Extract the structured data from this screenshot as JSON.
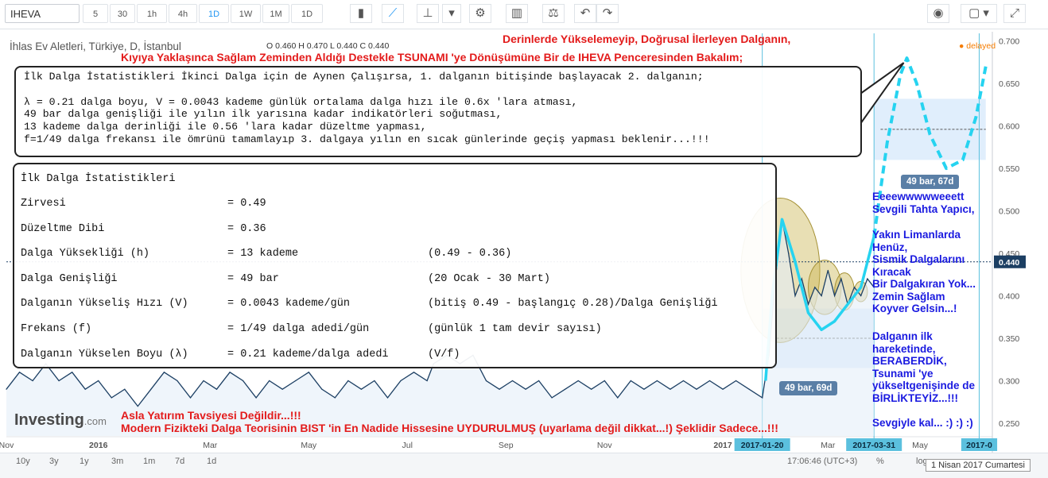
{
  "toolbar": {
    "symbol": "IHEVA",
    "intervals": [
      "5",
      "30",
      "1h",
      "4h",
      "1D",
      "1W",
      "1M",
      "1D"
    ],
    "active_interval": "1D"
  },
  "legend": {
    "title": "İhlas Ev Aletleri, Türkiye, D, İstanbul",
    "ohlc": "O 0.460 H 0.470 L 0.440 C 0.440",
    "delayed": "delayed"
  },
  "headline": {
    "line1": "Derinlerde Yükselemeyip, Doğrusal İlerleyen Dalganın,",
    "line2": "Kıyıya Yaklaşınca Sağlam Zeminden Aldığı Destekle TSUNAMI 'ye Dönüşümüne Bir de IHEVA Penceresinden Bakalım;"
  },
  "callout_lines": [
    "İlk Dalga İstatistikleri İkinci Dalga için de Aynen Çalışırsa, 1. dalganın bitişinde başlayacak 2. dalganın;",
    "",
    "λ = 0.21 dalga boyu, V = 0.0043 kademe günlük ortalama dalga hızı ile 0.6x 'lara atması,",
    "49 bar dalga genişliği ile yılın ilk yarısına kadar indikatörleri soğutması,",
    "13 kademe dalga derinliği ile 0.56 'lara kadar düzeltme yapması,",
    "f=1/49 dalga frekansı ile ömrünü tamamlayıp 3. dalgaya yılın en sıcak günlerinde geçiş yapması beklenir...!!!"
  ],
  "stats": {
    "title": "İlk Dalga İstatistikleri",
    "rows": [
      {
        "label": "Zirvesi",
        "value": "= 0.49",
        "note": ""
      },
      {
        "label": "Düzeltme Dibi",
        "value": "= 0.36",
        "note": ""
      },
      {
        "label": "Dalga Yüksekliği (h)",
        "value": "= 13 kademe",
        "note": "(0.49 - 0.36)"
      },
      {
        "label": "Dalga Genişliği",
        "value": "= 49 bar",
        "note": "(20 Ocak - 30 Mart)"
      },
      {
        "label": "Dalganın Yükseliş Hızı (V)",
        "value": "= 0.0043 kademe/gün",
        "note": "(bitiş 0.49 - başlangıç 0.28)/Dalga Genişliği"
      },
      {
        "label": "Frekans (f)",
        "value": "= 1/49 dalga adedi/gün",
        "note": "(günlük 1 tam devir sayısı)"
      },
      {
        "label": "Dalganın Yükselen Boyu (λ)",
        "value": "= 0.21 kademe/dalga adedi",
        "note": "(V/f)"
      }
    ]
  },
  "right_notes": {
    "block1": "Eeeewwwwweeett\nSevgili Tahta Yapıcı,",
    "block2": "Yakın Limanlarda\nHenüz,\nSismik Dalgalarını\nKıracak\nBir Dalgakıran Yok...\nZemin Sağlam\nKoyver Gelsin...!",
    "block3": "Dalganın ilk\nhareketinde,\nBERABERDİK,\nTsunami 'ye\nyükseltgenişinde de\nBİRLİKTEYİZ...!!!",
    "block4": "Sevgiyle kal... :) :) :)"
  },
  "footer": {
    "line1": "Asla Yatırım Tavsiyesi Değildir...!!!",
    "line2": "Modern Fizikteki Dalga Teorisinin BIST 'in En Nadide Hissesine UYDURULMUŞ (uyarlama değil dikkat...!) Şeklidir Sadece...!!!",
    "logo": "Investing",
    "logo_suffix": ".com"
  },
  "range_labels": {
    "first": "49 bar, 69d",
    "second": "49 bar, 67d"
  },
  "bottom": {
    "ranges": [
      "10y",
      "3y",
      "1y",
      "3m",
      "1m",
      "7d",
      "1d"
    ],
    "time": "17:06:46 (UTC+3)",
    "percent": "%",
    "log": "log",
    "date_tooltip": "1 Nisan 2017 Cumartesi"
  },
  "colors": {
    "price": "#1c3f63",
    "wave": "#26d3f0",
    "headline": "#e31b1b",
    "notes": "#1a1ae0",
    "range_fill": "#d6e8fb",
    "ellipse": "#c7b34d"
  },
  "chart_data": {
    "type": "line",
    "title": "İhlas Ev Aletleri, Türkiye, D, İstanbul",
    "ylim": [
      0.235,
      0.71
    ],
    "y_ticks": [
      0.25,
      0.3,
      0.35,
      0.4,
      0.45,
      0.5,
      0.55,
      0.6,
      0.65,
      0.7
    ],
    "x_tick_labels": [
      {
        "label": "Nov",
        "idx": 0
      },
      {
        "label": "2016",
        "idx": 28
      },
      {
        "label": "Mar",
        "idx": 62
      },
      {
        "label": "May",
        "idx": 92
      },
      {
        "label": "Jul",
        "idx": 122
      },
      {
        "label": "Sep",
        "idx": 152
      },
      {
        "label": "Nov",
        "idx": 182
      },
      {
        "label": "2017",
        "idx": 218
      },
      {
        "label": "2017-01-20",
        "idx": 230,
        "highlight": true
      },
      {
        "label": "Mar",
        "idx": 250
      },
      {
        "label": "2017-03-31",
        "idx": 264,
        "highlight": true
      },
      {
        "label": "May",
        "idx": 278
      },
      {
        "label": "2017-0",
        "idx": 296,
        "highlight": true
      }
    ],
    "current_price": 0.44,
    "price_series": [
      {
        "idx": 0,
        "v": 0.29
      },
      {
        "idx": 4,
        "v": 0.31
      },
      {
        "idx": 8,
        "v": 0.3
      },
      {
        "idx": 12,
        "v": 0.32
      },
      {
        "idx": 16,
        "v": 0.3
      },
      {
        "idx": 20,
        "v": 0.31
      },
      {
        "idx": 24,
        "v": 0.29
      },
      {
        "idx": 28,
        "v": 0.3
      },
      {
        "idx": 32,
        "v": 0.28
      },
      {
        "idx": 36,
        "v": 0.29
      },
      {
        "idx": 40,
        "v": 0.27
      },
      {
        "idx": 44,
        "v": 0.29
      },
      {
        "idx": 48,
        "v": 0.31
      },
      {
        "idx": 52,
        "v": 0.3
      },
      {
        "idx": 56,
        "v": 0.28
      },
      {
        "idx": 60,
        "v": 0.3
      },
      {
        "idx": 64,
        "v": 0.29
      },
      {
        "idx": 68,
        "v": 0.31
      },
      {
        "idx": 72,
        "v": 0.3
      },
      {
        "idx": 76,
        "v": 0.28
      },
      {
        "idx": 80,
        "v": 0.3
      },
      {
        "idx": 84,
        "v": 0.29
      },
      {
        "idx": 88,
        "v": 0.3
      },
      {
        "idx": 92,
        "v": 0.31
      },
      {
        "idx": 96,
        "v": 0.29
      },
      {
        "idx": 100,
        "v": 0.28
      },
      {
        "idx": 104,
        "v": 0.3
      },
      {
        "idx": 108,
        "v": 0.29
      },
      {
        "idx": 112,
        "v": 0.3
      },
      {
        "idx": 116,
        "v": 0.28
      },
      {
        "idx": 120,
        "v": 0.3
      },
      {
        "idx": 124,
        "v": 0.31
      },
      {
        "idx": 128,
        "v": 0.3
      },
      {
        "idx": 130,
        "v": 0.32
      },
      {
        "idx": 134,
        "v": 0.33
      },
      {
        "idx": 138,
        "v": 0.32
      },
      {
        "idx": 142,
        "v": 0.33
      },
      {
        "idx": 146,
        "v": 0.3
      },
      {
        "idx": 150,
        "v": 0.29
      },
      {
        "idx": 154,
        "v": 0.3
      },
      {
        "idx": 158,
        "v": 0.29
      },
      {
        "idx": 162,
        "v": 0.3
      },
      {
        "idx": 166,
        "v": 0.28
      },
      {
        "idx": 170,
        "v": 0.29
      },
      {
        "idx": 174,
        "v": 0.3
      },
      {
        "idx": 178,
        "v": 0.29
      },
      {
        "idx": 182,
        "v": 0.3
      },
      {
        "idx": 186,
        "v": 0.28
      },
      {
        "idx": 190,
        "v": 0.3
      },
      {
        "idx": 194,
        "v": 0.29
      },
      {
        "idx": 198,
        "v": 0.3
      },
      {
        "idx": 202,
        "v": 0.29
      },
      {
        "idx": 206,
        "v": 0.3
      },
      {
        "idx": 210,
        "v": 0.29
      },
      {
        "idx": 214,
        "v": 0.3
      },
      {
        "idx": 218,
        "v": 0.29
      },
      {
        "idx": 222,
        "v": 0.3
      },
      {
        "idx": 226,
        "v": 0.29
      },
      {
        "idx": 230,
        "v": 0.28
      },
      {
        "idx": 232,
        "v": 0.33
      },
      {
        "idx": 234,
        "v": 0.42
      },
      {
        "idx": 236,
        "v": 0.49
      },
      {
        "idx": 238,
        "v": 0.45
      },
      {
        "idx": 240,
        "v": 0.4
      },
      {
        "idx": 242,
        "v": 0.42
      },
      {
        "idx": 244,
        "v": 0.39
      },
      {
        "idx": 246,
        "v": 0.41
      },
      {
        "idx": 248,
        "v": 0.4
      },
      {
        "idx": 250,
        "v": 0.43
      },
      {
        "idx": 252,
        "v": 0.4
      },
      {
        "idx": 254,
        "v": 0.42
      },
      {
        "idx": 256,
        "v": 0.39
      },
      {
        "idx": 258,
        "v": 0.41
      },
      {
        "idx": 260,
        "v": 0.4
      },
      {
        "idx": 262,
        "v": 0.42
      },
      {
        "idx": 264,
        "v": 0.41
      }
    ],
    "wave_series": [
      {
        "idx": 231,
        "v": 0.3
      },
      {
        "idx": 233,
        "v": 0.4
      },
      {
        "idx": 236,
        "v": 0.49
      },
      {
        "idx": 240,
        "v": 0.44
      },
      {
        "idx": 244,
        "v": 0.38
      },
      {
        "idx": 248,
        "v": 0.36
      },
      {
        "idx": 252,
        "v": 0.37
      },
      {
        "idx": 256,
        "v": 0.39
      },
      {
        "idx": 260,
        "v": 0.41
      },
      {
        "idx": 264,
        "v": 0.47
      }
    ],
    "projection_series": [
      {
        "idx": 264,
        "v": 0.47
      },
      {
        "idx": 268,
        "v": 0.58
      },
      {
        "idx": 272,
        "v": 0.66
      },
      {
        "idx": 274,
        "v": 0.68
      },
      {
        "idx": 277,
        "v": 0.65
      },
      {
        "idx": 281,
        "v": 0.59
      },
      {
        "idx": 286,
        "v": 0.55
      },
      {
        "idx": 291,
        "v": 0.56
      },
      {
        "idx": 295,
        "v": 0.61
      },
      {
        "idx": 298,
        "v": 0.67
      }
    ]
  }
}
